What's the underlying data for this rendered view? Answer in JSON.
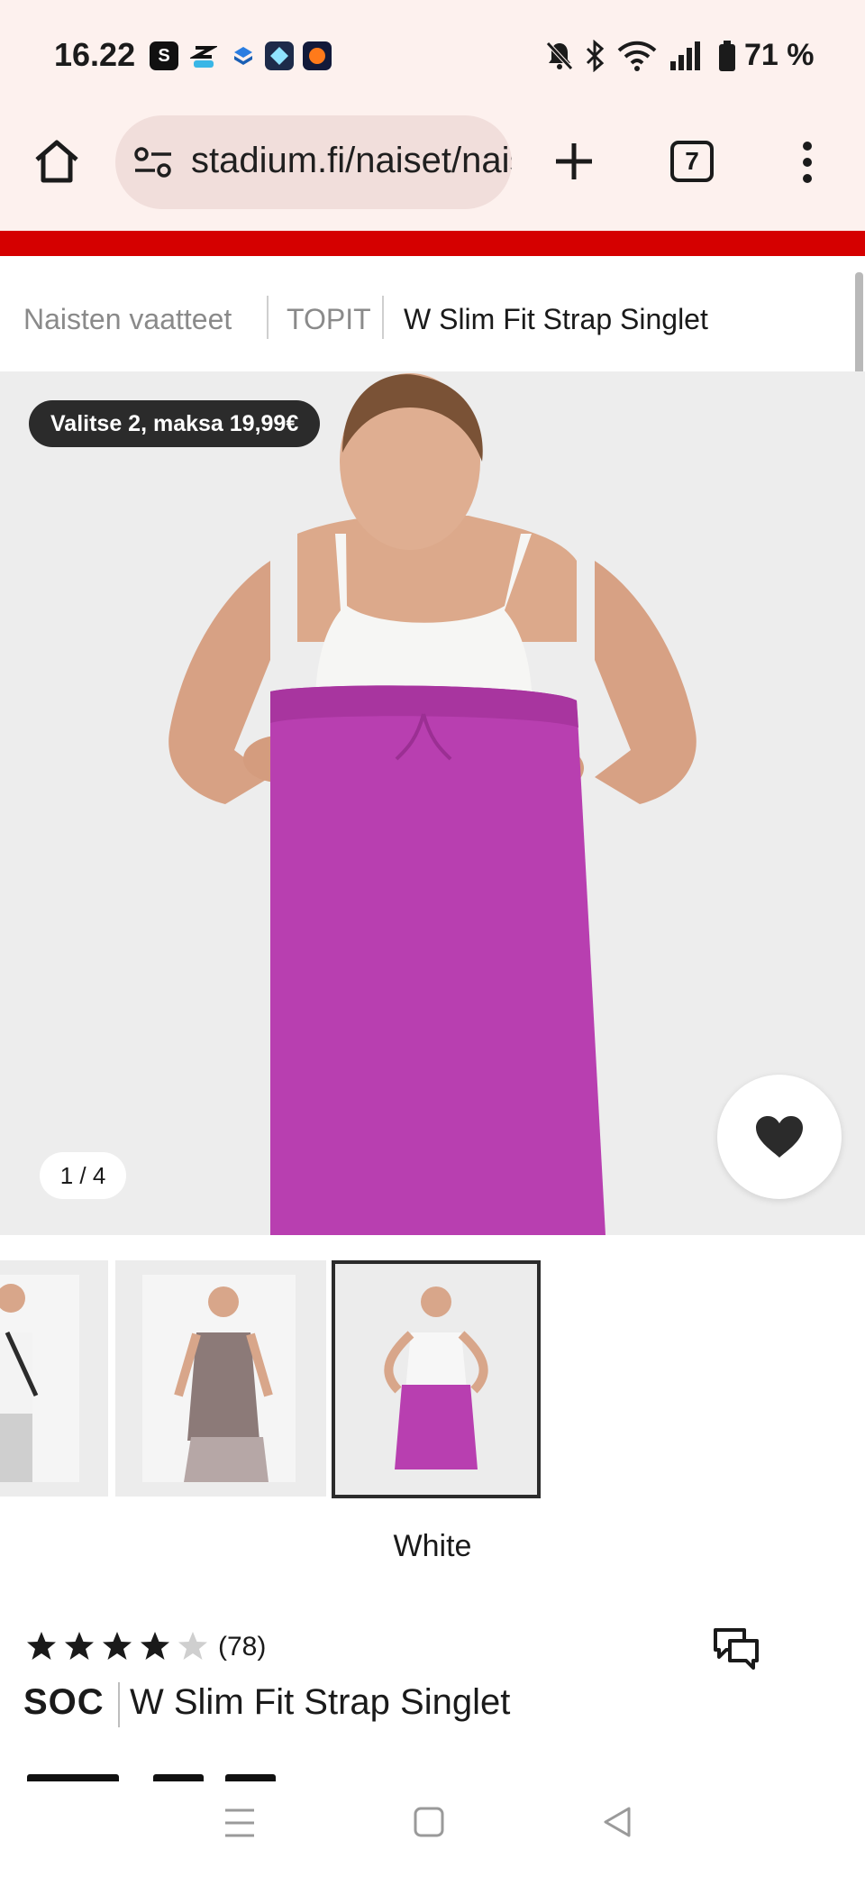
{
  "status_bar": {
    "time": "16.22",
    "app_icons": [
      "s-icon",
      "capcut-icon",
      "dropbox-icon",
      "app-diamond-icon",
      "app-orange-icon"
    ],
    "battery_percent": "71 %"
  },
  "browser": {
    "url": "stadium.fi/naiset/naiste",
    "tab_count": "7"
  },
  "breadcrumb": {
    "items": [
      "Naisten vaatteet",
      "TOPIT",
      "W Slim Fit Strap Singlet"
    ]
  },
  "product_image": {
    "promo_badge": "Valitse 2, maksa 19,99€",
    "image_counter": "1 / 4"
  },
  "thumbnails": {
    "selected_color": "White"
  },
  "product": {
    "rating": 4.5,
    "review_count": "(78)",
    "brand": "SOC",
    "title": "W Slim Fit Strap Singlet"
  },
  "colors": {
    "accent_red": "#d50000",
    "browser_bg": "#fdf1ee",
    "pants_magenta": "#b83fb0"
  }
}
